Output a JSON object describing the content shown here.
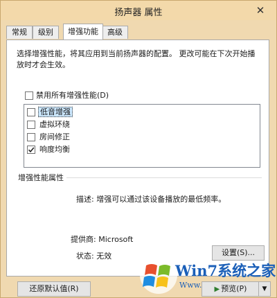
{
  "window": {
    "title": "扬声器 属性",
    "close_glyph": "✕"
  },
  "tabs": [
    {
      "label": "常规",
      "active": false
    },
    {
      "label": "级别",
      "active": false
    },
    {
      "label": "增强功能",
      "active": true
    },
    {
      "label": "高级",
      "active": false
    }
  ],
  "enhancements": {
    "description": "选择增强性能，将其应用到当前扬声器的配置。 更改可能在下次开始播放时才会生效。",
    "disable_all": {
      "label": "禁用所有增强性能(D)",
      "checked": false
    },
    "items": [
      {
        "label": "低音增强",
        "checked": false,
        "selected": true
      },
      {
        "label": "虚拟环绕",
        "checked": false,
        "selected": false
      },
      {
        "label": "房间修正",
        "checked": false,
        "selected": false
      },
      {
        "label": "响度均衡",
        "checked": true,
        "selected": false
      }
    ]
  },
  "properties": {
    "group_title": "增强性能属性",
    "description": "描述: 增强可以通过该设备播放的最低频率。",
    "provider_label": "提供商:",
    "provider_value": "Microsoft",
    "status_label": "状态:",
    "status_value": "无效",
    "settings_button": "设置(S)..."
  },
  "footer": {
    "restore_defaults": "还原默认值(R)",
    "preview": "预览(P)",
    "preview_glyph": "▶",
    "dropdown_glyph": "▼"
  },
  "watermark": {
    "title": "Win7系统之家",
    "url": "Www.Winwin7.com"
  },
  "colors": {
    "window_bg": "#f0d9b0",
    "panel_bg": "#ffffff",
    "selection": "#cce8ff",
    "watermark_blue": "#1b5fb8"
  }
}
